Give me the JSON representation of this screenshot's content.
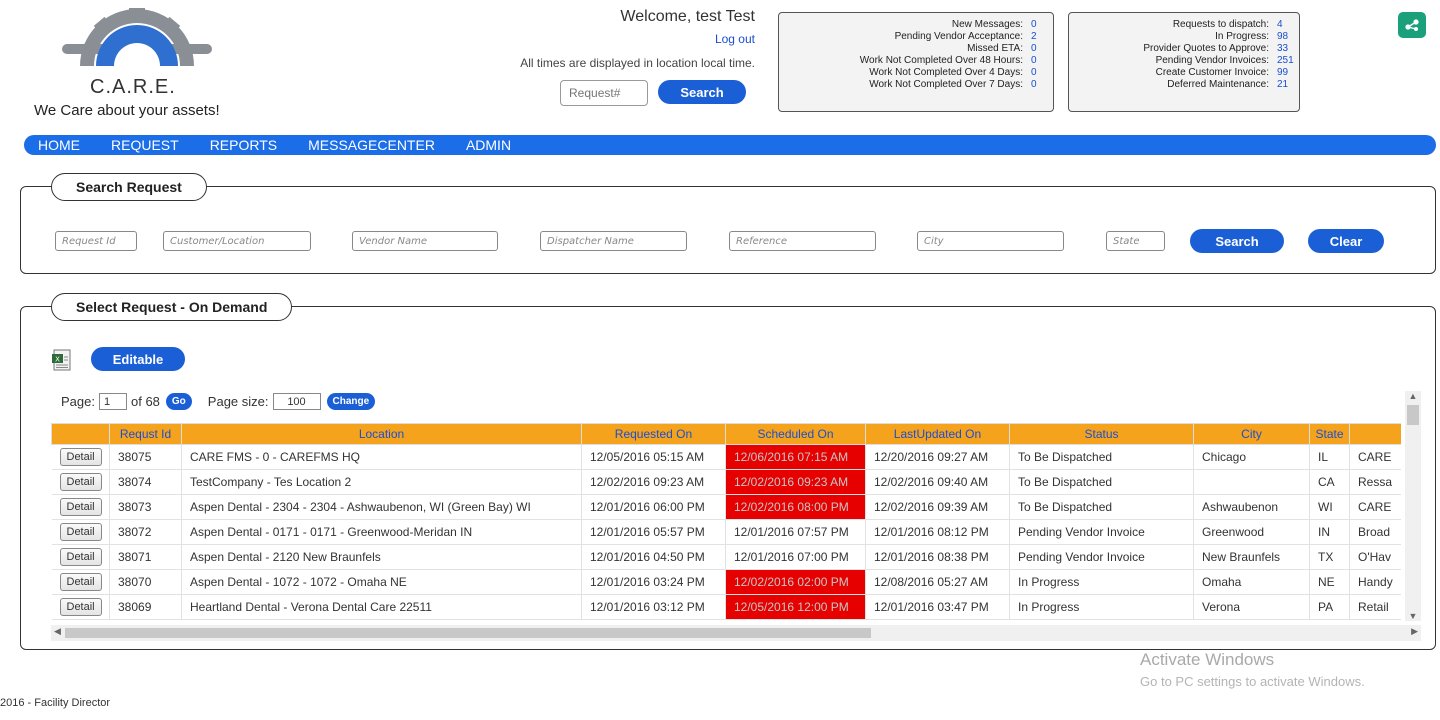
{
  "brand": {
    "name": "C.A.R.E.",
    "tagline": "We Care about your assets!",
    "logo_icon": "gear-logo-icon",
    "accent": "#1b6de8"
  },
  "header": {
    "welcome": "Welcome, test Test",
    "logout": "Log out",
    "timezone_note": "All times are displayed in location local time.",
    "request_placeholder": "Request#",
    "search_label": "Search"
  },
  "stats_left": [
    {
      "label": "New Messages:",
      "value": "0"
    },
    {
      "label": "Pending Vendor Acceptance:",
      "value": "2"
    },
    {
      "label": "Missed ETA:",
      "value": "0"
    },
    {
      "label": "Work Not Completed Over 48 Hours:",
      "value": "0"
    },
    {
      "label": "Work Not Completed Over 4 Days:",
      "value": "0"
    },
    {
      "label": "Work Not Completed Over 7 Days:",
      "value": "0"
    }
  ],
  "stats_right": [
    {
      "label": "Requests to dispatch:",
      "value": "4"
    },
    {
      "label": "In Progress:",
      "value": "98"
    },
    {
      "label": "Provider Quotes to Approve:",
      "value": "33"
    },
    {
      "label": "Pending Vendor Invoices:",
      "value": "251"
    },
    {
      "label": "Create Customer Invoice:",
      "value": "99"
    },
    {
      "label": "Deferred Maintenance:",
      "value": "21"
    }
  ],
  "nav": [
    "HOME",
    "REQUEST",
    "REPORTS",
    "MESSAGECENTER",
    "ADMIN"
  ],
  "search_panel": {
    "title": "Search Request",
    "filters": [
      {
        "name": "request-id-filter",
        "placeholder": "Request Id"
      },
      {
        "name": "customer-location-filter",
        "placeholder": "Customer/Location"
      },
      {
        "name": "vendor-name-filter",
        "placeholder": "Vendor Name"
      },
      {
        "name": "dispatcher-name-filter",
        "placeholder": "Dispatcher Name"
      },
      {
        "name": "reference-filter",
        "placeholder": "Reference"
      },
      {
        "name": "city-filter",
        "placeholder": "City"
      },
      {
        "name": "state-filter",
        "placeholder": "State"
      }
    ],
    "search_label": "Search",
    "clear_label": "Clear"
  },
  "select_panel": {
    "title": "Select Request - On Demand",
    "editable_label": "Editable",
    "page_label": "Page:",
    "page_value": "1",
    "of_pages": "of 68",
    "go_label": "Go",
    "page_size_label": "Page size:",
    "page_size_value": "100",
    "change_label": "Change"
  },
  "table": {
    "detail_label": "Detail",
    "columns": [
      "",
      "Requst Id",
      "Location",
      "Requested On",
      "Scheduled On",
      "LastUpdated On",
      "Status",
      "City",
      "State",
      ""
    ],
    "rows": [
      {
        "id": "38075",
        "location": "CARE FMS - 0 - CAREFMS HQ",
        "requested": "12/05/2016 05:15 AM",
        "scheduled": "12/06/2016 07:15 AM",
        "scheduled_overdue": true,
        "updated": "12/20/2016 09:27 AM",
        "status": "To Be Dispatched",
        "city": "Chicago",
        "state": "IL",
        "vendor": "CARE"
      },
      {
        "id": "38074",
        "location": "TestCompany - Tes Location 2",
        "requested": "12/02/2016 09:23 AM",
        "scheduled": "12/02/2016 09:23 AM",
        "scheduled_overdue": true,
        "updated": "12/02/2016 09:40 AM",
        "status": "To Be Dispatched",
        "city": "",
        "state": "CA",
        "vendor": "Ressa"
      },
      {
        "id": "38073",
        "location": "Aspen Dental - 2304 - 2304 - Ashwaubenon, WI (Green Bay) WI",
        "requested": "12/01/2016 06:00 PM",
        "scheduled": "12/02/2016 08:00 PM",
        "scheduled_overdue": true,
        "updated": "12/02/2016 09:39 AM",
        "status": "To Be Dispatched",
        "city": "Ashwaubenon",
        "state": "WI",
        "vendor": "CARE"
      },
      {
        "id": "38072",
        "location": "Aspen Dental - 0171 - 0171 - Greenwood-Meridan IN",
        "requested": "12/01/2016 05:57 PM",
        "scheduled": "12/01/2016 07:57 PM",
        "scheduled_overdue": false,
        "updated": "12/01/2016 08:12 PM",
        "status": "Pending Vendor Invoice",
        "city": "Greenwood",
        "state": "IN",
        "vendor": "Broad"
      },
      {
        "id": "38071",
        "location": "Aspen Dental - 2120 New Braunfels",
        "requested": "12/01/2016 04:50 PM",
        "scheduled": "12/01/2016 07:00 PM",
        "scheduled_overdue": false,
        "updated": "12/01/2016 08:38 PM",
        "status": "Pending Vendor Invoice",
        "city": "New Braunfels",
        "state": "TX",
        "vendor": "O'Hav"
      },
      {
        "id": "38070",
        "location": "Aspen Dental - 1072 - 1072 - Omaha NE",
        "requested": "12/01/2016 03:24 PM",
        "scheduled": "12/02/2016 02:00 PM",
        "scheduled_overdue": true,
        "updated": "12/08/2016 05:27 AM",
        "status": "In Progress",
        "city": "Omaha",
        "state": "NE",
        "vendor": "Handy"
      },
      {
        "id": "38069",
        "location": "Heartland Dental - Verona Dental Care 22511",
        "requested": "12/01/2016 03:12 PM",
        "scheduled": "12/05/2016 12:00 PM",
        "scheduled_overdue": true,
        "updated": "12/01/2016 03:47 PM",
        "status": "In Progress",
        "city": "Verona",
        "state": "PA",
        "vendor": "Retail"
      }
    ]
  },
  "watermark": {
    "line1": "Activate Windows",
    "line2": "Go to PC settings to activate Windows."
  },
  "footer": "2016 - Facility Director",
  "colors": {
    "header_orange": "#f5a21d",
    "overdue_red": "#e60000",
    "link_blue": "#1a4fd0"
  }
}
